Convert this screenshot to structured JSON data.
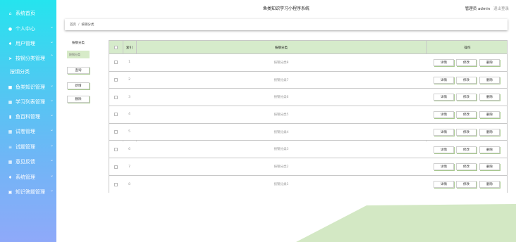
{
  "app": {
    "title": "鱼类知识学习小程序系统",
    "user_label": "管理员 admin",
    "logout_label": "退出登录"
  },
  "sidebar": {
    "items": [
      {
        "label": "系统首页",
        "icon": "home-icon",
        "glyph": "⌂",
        "arrow": false
      },
      {
        "label": "个人中心",
        "icon": "user-icon",
        "glyph": "●",
        "arrow": true
      },
      {
        "label": "用户管理",
        "icon": "pin-icon",
        "glyph": "♦",
        "arrow": true
      },
      {
        "label": "按钢分类管理",
        "icon": "send-icon",
        "glyph": "➤",
        "arrow": true
      },
      {
        "label": "按钢分类",
        "icon": "",
        "glyph": "",
        "arrow": false,
        "sub": true
      },
      {
        "label": "鱼类知识管理",
        "icon": "book-icon",
        "glyph": "■",
        "arrow": true
      },
      {
        "label": "学习列表管理",
        "icon": "grid-icon",
        "glyph": "▦",
        "arrow": true
      },
      {
        "label": "鱼百科管理",
        "icon": "chart-icon",
        "glyph": "▮",
        "arrow": true
      },
      {
        "label": "试卷管理",
        "icon": "grid-icon",
        "glyph": "▦",
        "arrow": true
      },
      {
        "label": "试题管理",
        "icon": "list-icon",
        "glyph": "≡",
        "arrow": true
      },
      {
        "label": "意见反馈",
        "icon": "grid-icon",
        "glyph": "▦",
        "arrow": true
      },
      {
        "label": "系统管理",
        "icon": "pin-icon",
        "glyph": "♦",
        "arrow": true
      },
      {
        "label": "知识答题管理",
        "icon": "card-icon",
        "glyph": "▣",
        "arrow": true
      }
    ]
  },
  "breadcrumb": {
    "home": "首页",
    "separator": "/",
    "current": "按钢分类"
  },
  "filter": {
    "field_label": "按钢分类",
    "input_placeholder": "按钢分类",
    "search_label": "查询",
    "add_label": "新增",
    "delete_label": "删除"
  },
  "table": {
    "headers": {
      "index": "索引",
      "category": "按钢分类",
      "actions": "操作"
    },
    "actions": {
      "detail": "详情",
      "edit": "修改",
      "delete": "删除"
    },
    "rows": [
      {
        "index": "1",
        "category": "按钢分类8"
      },
      {
        "index": "2",
        "category": "按钢分类7"
      },
      {
        "index": "3",
        "category": "按钢分类6"
      },
      {
        "index": "4",
        "category": "按钢分类5"
      },
      {
        "index": "5",
        "category": "按钢分类4"
      },
      {
        "index": "6",
        "category": "按钢分类3"
      },
      {
        "index": "7",
        "category": "按钢分类2"
      },
      {
        "index": "8",
        "category": "按钢分类1"
      }
    ]
  },
  "colors": {
    "accent_green": "#d6ebcb",
    "sidebar_top": "#25e4ee",
    "sidebar_bottom": "#8fa9f9",
    "decoration": "#d3e8c4"
  }
}
